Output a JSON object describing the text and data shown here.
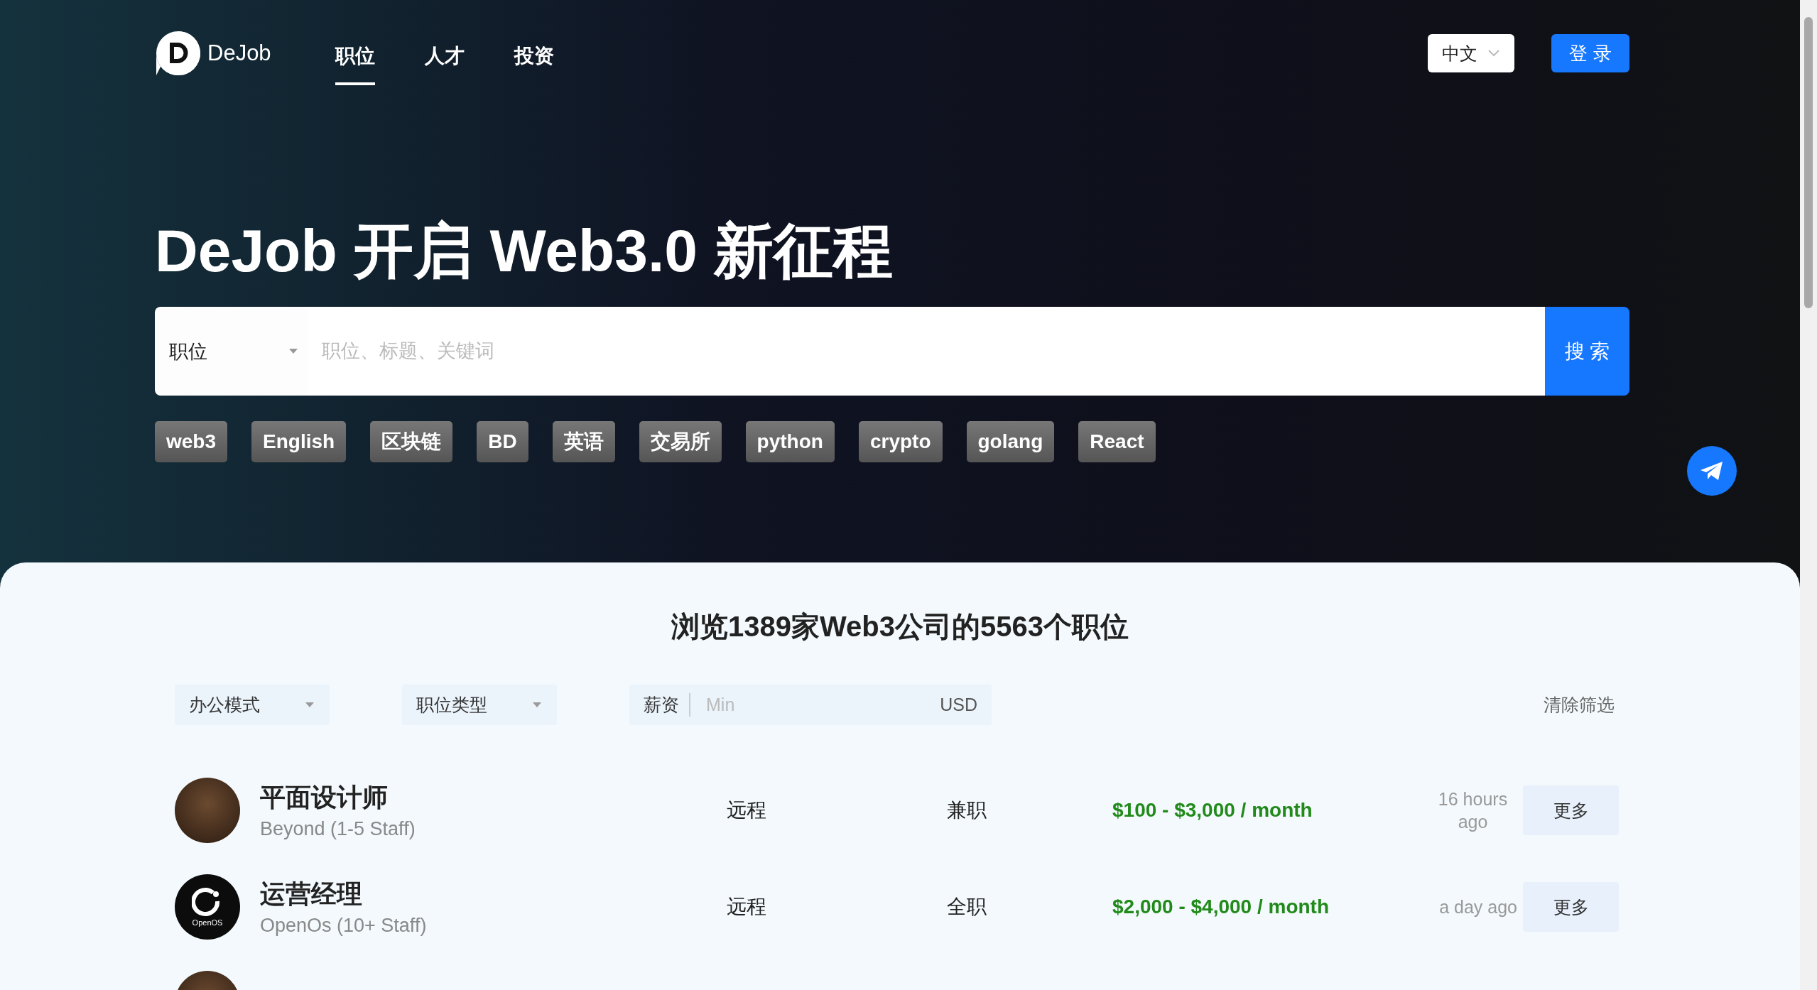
{
  "header": {
    "logo_text": "DeJob",
    "nav": [
      {
        "label": "职位",
        "selected": true
      },
      {
        "label": "人才",
        "selected": false
      },
      {
        "label": "投资",
        "selected": false
      }
    ],
    "language": "中文",
    "login": "登 录"
  },
  "hero": {
    "title": "DeJob 开启 Web3.0 新征程",
    "search": {
      "category": "职位",
      "placeholder": "职位、标题、关键词",
      "button": "搜 索"
    },
    "tags": [
      "web3",
      "English",
      "区块链",
      "BD",
      "英语",
      "交易所",
      "python",
      "crypto",
      "golang",
      "React"
    ]
  },
  "jobs_section": {
    "heading": "浏览1389家Web3公司的5563个职位",
    "filters": {
      "work_mode": "办公模式",
      "job_type": "职位类型",
      "salary_label": "薪资",
      "salary_min_placeholder": "Min",
      "currency": "USD",
      "clear": "清除筛选"
    },
    "jobs": [
      {
        "kind": "photo",
        "title": "平面设计师",
        "company": "Beyond (1-5 Staff)",
        "location": "远程",
        "type": "兼职",
        "salary": "$100 - $3,000 / month",
        "posted": "16 hours ago",
        "more": "更多"
      },
      {
        "kind": "logo",
        "logo_text": "OpenOS",
        "title": "运营经理",
        "company": "OpenOs (10+ Staff)",
        "location": "远程",
        "type": "全职",
        "salary": "$2,000 - $4,000 / month",
        "posted": "a day ago",
        "more": "更多"
      },
      {
        "kind": "photo"
      }
    ]
  }
}
